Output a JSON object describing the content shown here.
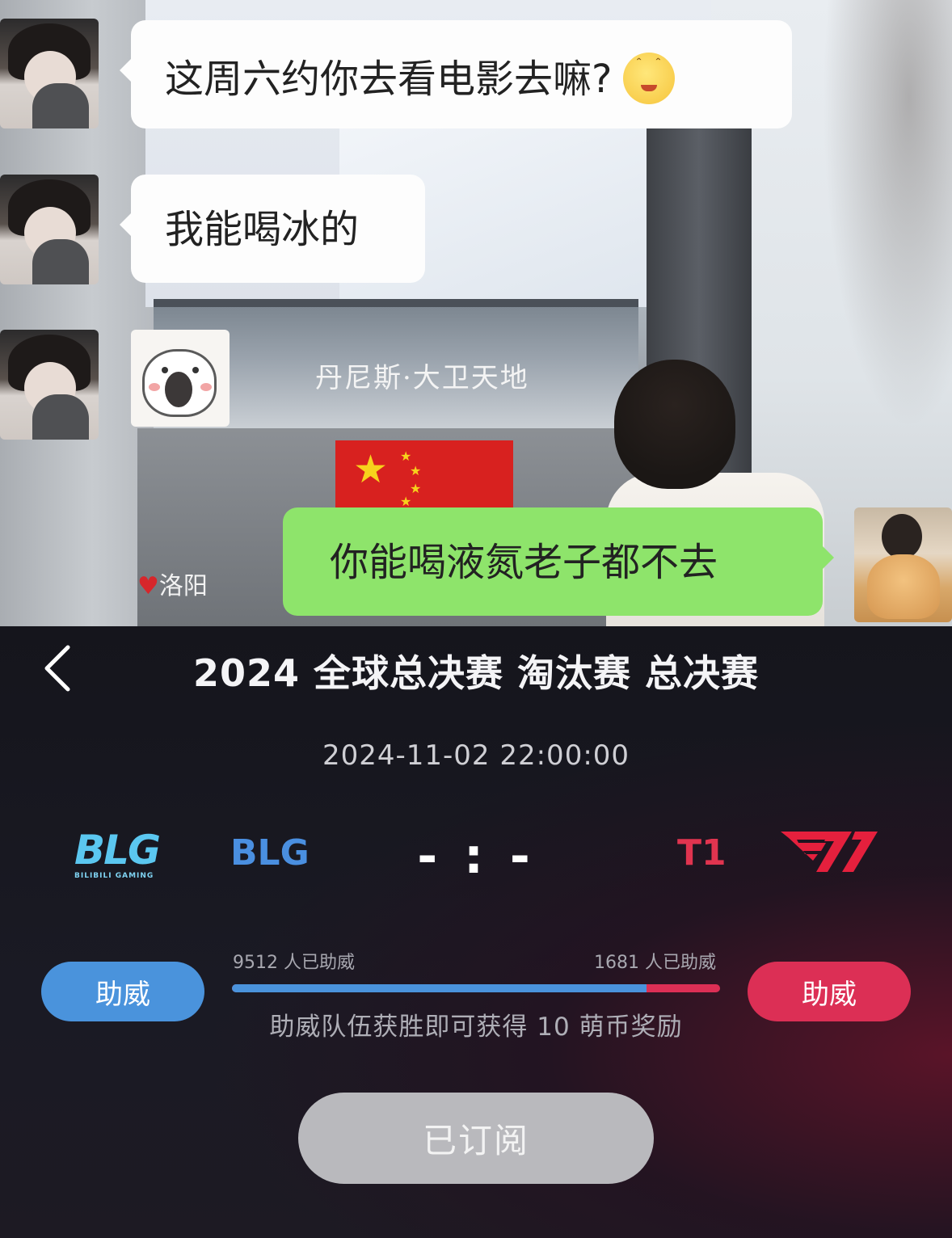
{
  "chat": {
    "messages": [
      {
        "side": "left",
        "sender": "friend",
        "text": "这周六约你去看电影去嘛?",
        "emoji": "smiling-face-emoji"
      },
      {
        "side": "left",
        "sender": "friend",
        "text": "我能喝冰的"
      },
      {
        "side": "left",
        "sender": "friend",
        "type": "sticker",
        "sticker": "shocked-bear-sticker"
      },
      {
        "side": "right",
        "sender": "me",
        "text": "你能喝液氮老子都不去"
      }
    ],
    "background": {
      "sign_text": "丹尼斯·大卫天地",
      "ad_text": "洛阳"
    }
  },
  "match": {
    "title": "2024 全球总决赛 淘汰赛 总决赛",
    "datetime": "2024-11-02 22:00:00",
    "left_team": {
      "name": "BLG",
      "logo_text": "BLG",
      "logo_subtext": "BILIBILI GAMING",
      "color": "#4a8fe0"
    },
    "right_team": {
      "name": "T1",
      "logo_text": "T1",
      "color": "#e0344f"
    },
    "score": "- : -",
    "cheer": {
      "button_label_left": "助威",
      "button_label_right": "助威",
      "left_count_text": "9512 人已助威",
      "right_count_text": "1681 人已助威",
      "left_share": 0.85,
      "reward_text": "助威队伍获胜即可获得 10 萌币奖励"
    },
    "subscribe_label": "已订阅"
  },
  "colors": {
    "blg_blue": "#4a93dc",
    "t1_red": "#dc2f55",
    "chat_green": "#8ee46b"
  }
}
